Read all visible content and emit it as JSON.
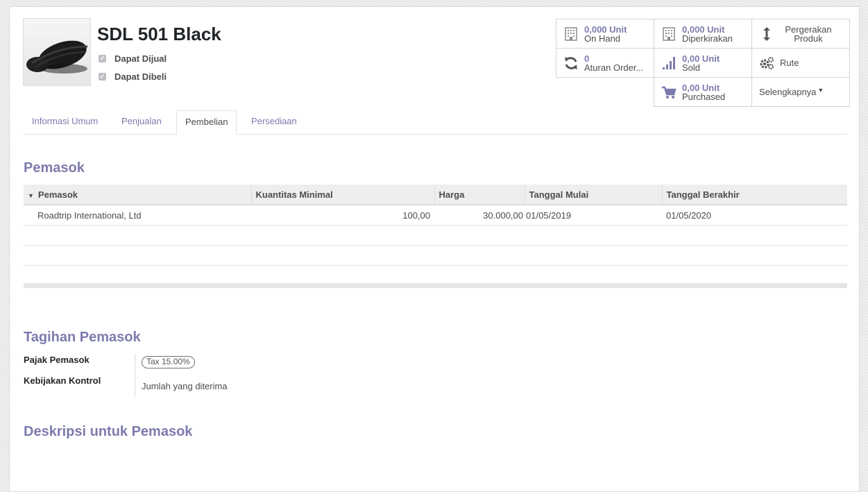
{
  "product": {
    "name": "SDL 501 Black",
    "can_be_sold_label": "Dapat Dijual",
    "can_be_purchased_label": "Dapat Dibeli"
  },
  "stat_buttons": {
    "on_hand": {
      "value": "0,000 Unit",
      "label": "On Hand"
    },
    "forecast": {
      "value": "0,000 Unit",
      "label": "Diperkirakan"
    },
    "moves": {
      "label": "Pergerakan Produk"
    },
    "reorder": {
      "value": "0",
      "label": "Aturan Order..."
    },
    "sold": {
      "value": "0,00 Unit",
      "label": "Sold"
    },
    "routes": {
      "label": "Rute"
    },
    "purchased": {
      "value": "0,00 Unit",
      "label": "Purchased"
    },
    "more": {
      "label": "Selengkapnya"
    }
  },
  "tabs": [
    "Informasi Umum",
    "Penjualan",
    "Pembelian",
    "Persediaan"
  ],
  "active_tab": "Pembelian",
  "vendors": {
    "section_title": "Pemasok",
    "columns": [
      "Pemasok",
      "Kuantitas Minimal",
      "Harga",
      "Tanggal Mulai",
      "Tanggal Berakhir"
    ],
    "rows": [
      [
        "Roadtrip International, Ltd",
        "100,00",
        "30.000,00",
        "01/05/2019",
        "01/05/2020"
      ]
    ]
  },
  "vendor_bills": {
    "section_title": "Tagihan Pemasok",
    "tax_label": "Pajak Pemasok",
    "tax_value": "Tax 15.00%",
    "control_label": "Kebijakan Kontrol",
    "control_value": "Jumlah yang diterima"
  },
  "vendor_description": {
    "section_title": "Deskripsi untuk Pemasok"
  },
  "colors": {
    "accent": "#7c7bad",
    "text": "#4c4c4c",
    "header_bg": "#eeeeee"
  }
}
